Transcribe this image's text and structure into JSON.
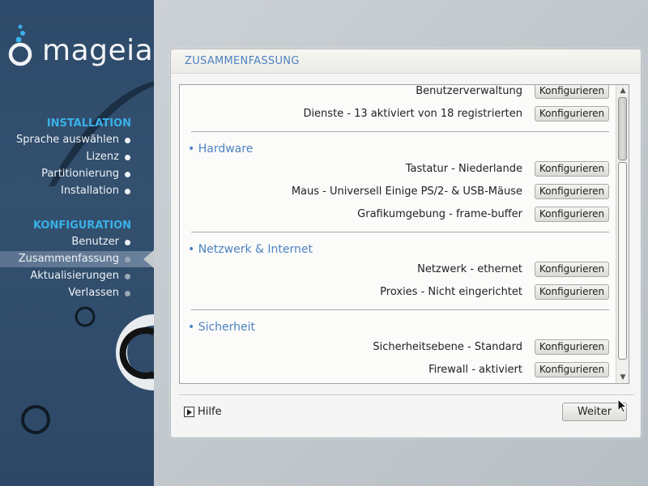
{
  "brand": {
    "logo_text": "mageia"
  },
  "sidebar": {
    "installation_title": "INSTALLATION",
    "installation_items": [
      {
        "label": "Sprache auswählen",
        "state": "done"
      },
      {
        "label": "Lizenz",
        "state": "done"
      },
      {
        "label": "Partitionierung",
        "state": "done"
      },
      {
        "label": "Installation",
        "state": "done"
      }
    ],
    "configuration_title": "KONFIGURATION",
    "configuration_items": [
      {
        "label": "Benutzer",
        "state": "done"
      },
      {
        "label": "Zusammenfassung",
        "state": "current"
      },
      {
        "label": "Aktualisierungen",
        "state": "pending"
      },
      {
        "label": "Verlassen",
        "state": "pending"
      }
    ]
  },
  "panel": {
    "title": "ZUSAMMENFASSUNG",
    "button_label": "Konfigurieren",
    "rows_top": [
      {
        "label": "Benutzerverwaltung"
      },
      {
        "label": "Dienste - 13 aktiviert von 18 registrierten"
      }
    ],
    "groups": [
      {
        "title": "• Hardware",
        "rows": [
          {
            "label": "Tastatur - Niederlande"
          },
          {
            "label": "Maus - Universell Einige PS/2- & USB-Mäuse"
          },
          {
            "label": "Grafikumgebung - frame-buffer"
          }
        ]
      },
      {
        "title": "• Netzwerk & Internet",
        "rows": [
          {
            "label": "Netzwerk - ethernet"
          },
          {
            "label": "Proxies - Nicht eingerichtet"
          }
        ]
      },
      {
        "title": "• Sicherheit",
        "rows": [
          {
            "label": "Sicherheitsebene - Standard"
          },
          {
            "label": "Firewall - aktiviert"
          }
        ]
      }
    ]
  },
  "footer": {
    "help_label": "Hilfe",
    "next_label": "Weiter"
  },
  "icons": {
    "scroll_up": "▲",
    "scroll_down": "▼"
  },
  "colors": {
    "accent": "#4d82c2",
    "sidebar_accent": "#3ab0e8",
    "sidebar_bg": "#2e4a6a"
  }
}
